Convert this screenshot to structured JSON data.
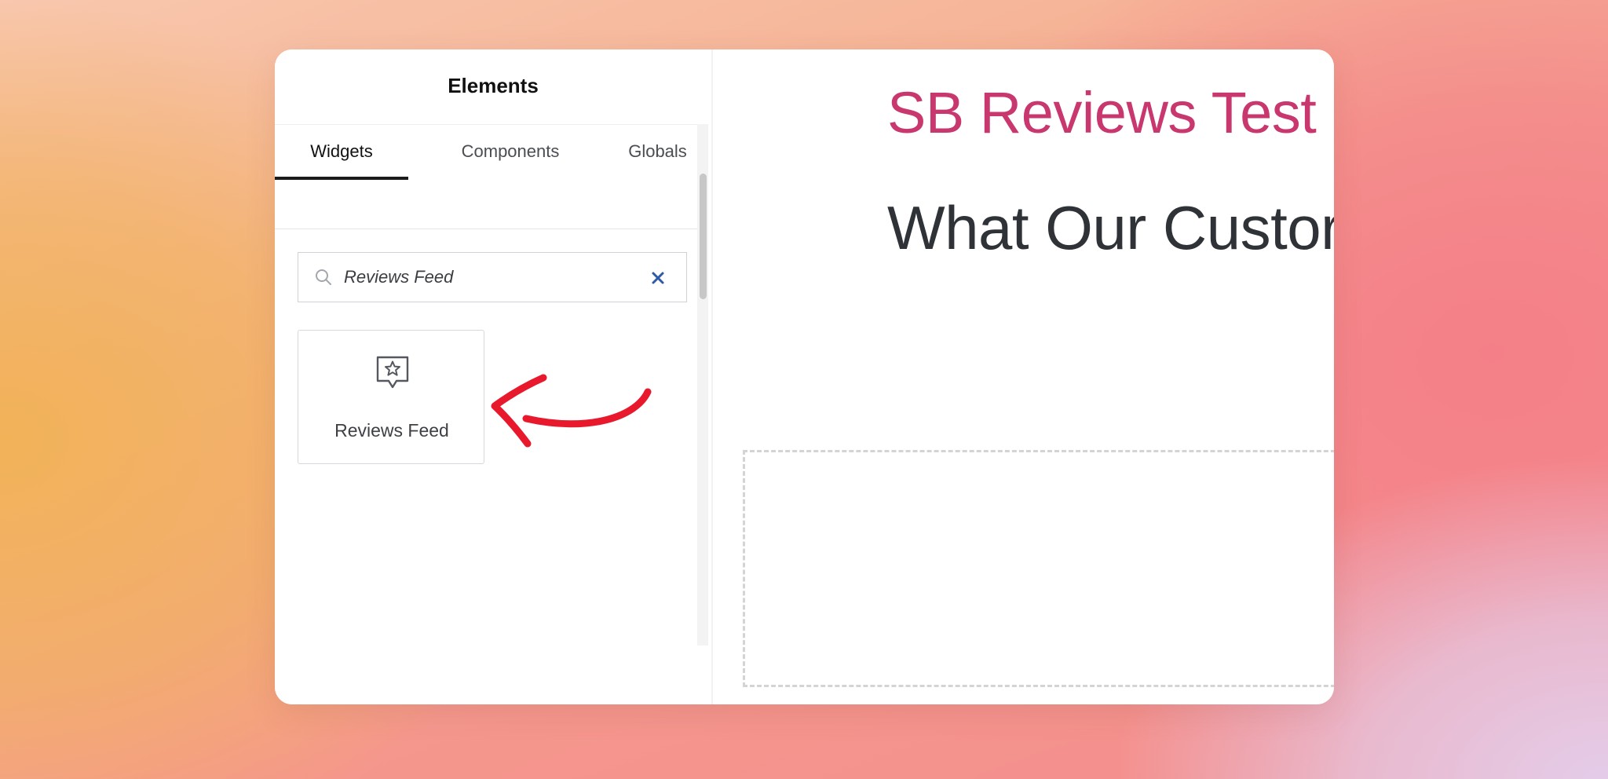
{
  "panel": {
    "title": "Elements",
    "tabs": [
      {
        "label": "Widgets",
        "active": true
      },
      {
        "label": "Components",
        "active": false
      },
      {
        "label": "Globals",
        "active": false
      }
    ],
    "search": {
      "value": "Reviews Feed",
      "placeholder": "Search Widget..."
    },
    "widgets": [
      {
        "label": "Reviews Feed",
        "icon": "star-badge-icon"
      }
    ]
  },
  "canvas": {
    "site_title": "SB Reviews Test",
    "heading": "What Our Custor"
  },
  "colors": {
    "site_title": "#c8386e",
    "heading": "#2f3236",
    "annotation_arrow": "#e8192c"
  }
}
